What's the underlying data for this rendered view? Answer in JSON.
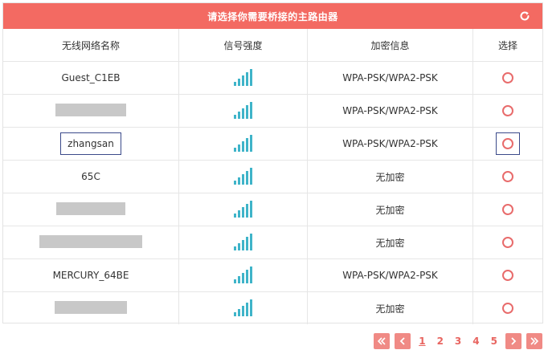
{
  "title": "请选择你需要桥接的主路由器",
  "icons": {
    "refresh": "refresh-icon",
    "first": "double-chevron-left-icon",
    "prev": "chevron-left-icon",
    "next": "chevron-right-icon",
    "last": "double-chevron-right-icon"
  },
  "colors": {
    "accent": "#f36a62",
    "signal": "#3fb4c9",
    "radio": "#e86b6b",
    "focus": "#3b4a8a"
  },
  "columns": [
    "无线网络名称",
    "信号强度",
    "加密信息",
    "选择"
  ],
  "rows": [
    {
      "ssid": "Guest_C1EB",
      "encryption": "WPA-PSK/WPA2-PSK",
      "signal_bars": 5,
      "selected": false
    },
    {
      "ssid": "",
      "redacted": true,
      "encryption": "WPA-PSK/WPA2-PSK",
      "signal_bars": 5,
      "selected": false
    },
    {
      "ssid": "zhangsan",
      "encryption": "WPA-PSK/WPA2-PSK",
      "signal_bars": 5,
      "selected": false,
      "focused": true
    },
    {
      "ssid": "65C",
      "encryption": "无加密",
      "signal_bars": 5,
      "selected": false
    },
    {
      "ssid": "",
      "redacted": true,
      "encryption": "无加密",
      "signal_bars": 5,
      "selected": false
    },
    {
      "ssid": "",
      "redacted": true,
      "encryption": "无加密",
      "signal_bars": 5,
      "selected": false
    },
    {
      "ssid": "MERCURY_64BE",
      "encryption": "WPA-PSK/WPA2-PSK",
      "signal_bars": 5,
      "selected": false
    },
    {
      "ssid": "",
      "redacted": true,
      "encryption": "无加密",
      "signal_bars": 5,
      "selected": false
    }
  ],
  "pagination": {
    "pages": [
      "1",
      "2",
      "3",
      "4",
      "5"
    ],
    "current": "1"
  }
}
